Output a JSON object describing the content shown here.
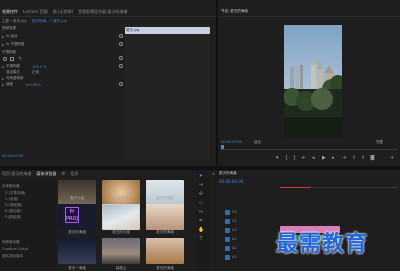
{
  "effect_controls": {
    "tabs": [
      "效果控件",
      "Lumetri 范围",
      "源:(无剪辑)",
      "音频剪辑混合器:夏天的海滩"
    ],
    "header": {
      "master": "主要 * 夏天.jpg",
      "clip": "夏天的海... * 夏天.jpg",
      "clip_chip": "夏天.jpg"
    },
    "rows": [
      {
        "label": "视频效果"
      },
      {
        "label": "fx 运动"
      },
      {
        "label": "fx 不透明度"
      },
      {
        "label": "不透明度",
        "value": "100.0 %"
      },
      {
        "label": "混合模式",
        "value": "正常"
      },
      {
        "label": "时间重映射"
      },
      {
        "label": "速度",
        "value": "100.00%"
      }
    ],
    "timecode": "00:00:00:00"
  },
  "program_monitor": {
    "title": "节目: 夏天的海滩",
    "timecode": "00:00:00:00",
    "fit": "适合",
    "quality": "完整"
  },
  "project_panel": {
    "tabs": [
      "项目:夏天的海滩",
      "媒体浏览器",
      "库",
      "信息"
    ],
    "tree": [
      "本地驱动器",
      "Z:(共享存储)",
      "C:(系统)",
      "D:(新加卷)",
      "E:(新加卷)",
      "F:(新加卷)",
      "网络驱动器",
      "Creative Cloud",
      "团队项目版本"
    ],
    "items": [
      {
        "label": "骆子沙滩"
      },
      {
        "label": "二手的海"
      },
      {
        "label": "夏天的海滩"
      },
      {
        "label": "夏天的海滩"
      },
      {
        "label": "夏日的沙滩"
      },
      {
        "label": "夏天的海滩"
      },
      {
        "label": "夏天一海滩"
      },
      {
        "label": "高楼山"
      },
      {
        "label": "夏天的海滩"
      }
    ],
    "prproj_label": "Pr PROJ"
  },
  "timeline": {
    "title": "夏天的海滩",
    "timecode": "00:00:00:00",
    "tracks": [
      "V3",
      "V2",
      "V1",
      "A1",
      "A2",
      "A3"
    ]
  },
  "watermark": "最需教育",
  "colors": {
    "accent": "#3f8cd6",
    "clip_pink": "#d87fb6",
    "timeline_red": "#d63b3b"
  }
}
